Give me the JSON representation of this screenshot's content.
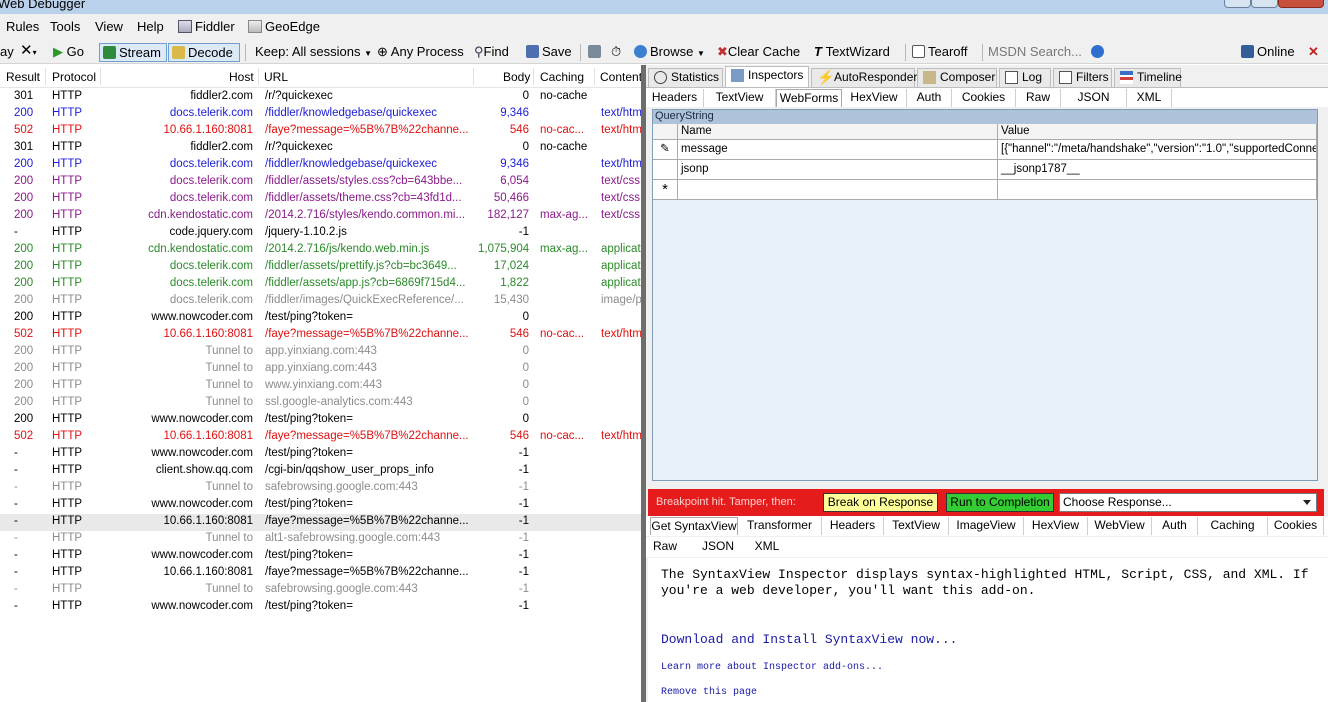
{
  "window": {
    "title": "Web Debugger"
  },
  "menu": [
    "Rules",
    "Tools",
    "View",
    "Help",
    "Fiddler",
    "GeoEdge"
  ],
  "toolbar": {
    "replay": "ay",
    "go": "Go",
    "stream": "Stream",
    "decode": "Decode",
    "keep": "Keep: All sessions",
    "process": "Any Process",
    "find": "Find",
    "save": "Save",
    "browse": "Browse",
    "clear_cache": "Clear Cache",
    "textwizard": "TextWizard",
    "tearoff": "Tearoff",
    "msdn_placeholder": "MSDN Search...",
    "online": "Online"
  },
  "sessions": {
    "columns": [
      "Result",
      "Protocol",
      "Host",
      "URL",
      "Body",
      "Caching",
      "Content"
    ],
    "rows": [
      {
        "result": "301",
        "protocol": "HTTP",
        "host": "fiddler2.com",
        "url": "/r/?quickexec",
        "body": "0",
        "caching": "no-cache",
        "content": "",
        "color": "#000000"
      },
      {
        "result": "200",
        "protocol": "HTTP",
        "host": "docs.telerik.com",
        "url": "/fiddler/knowledgebase/quickexec",
        "body": "9,346",
        "caching": "",
        "content": "text/htm",
        "color": "#1c1cd6"
      },
      {
        "result": "502",
        "protocol": "HTTP",
        "host": "10.66.1.160:8081",
        "url": "/faye?message=%5B%7B%22channe...",
        "body": "546",
        "caching": "no-cac...",
        "content": "text/htm",
        "color": "#e01010"
      },
      {
        "result": "301",
        "protocol": "HTTP",
        "host": "fiddler2.com",
        "url": "/r/?quickexec",
        "body": "0",
        "caching": "no-cache",
        "content": "",
        "color": "#000000"
      },
      {
        "result": "200",
        "protocol": "HTTP",
        "host": "docs.telerik.com",
        "url": "/fiddler/knowledgebase/quickexec",
        "body": "9,346",
        "caching": "",
        "content": "text/htm",
        "color": "#1c1cd6"
      },
      {
        "result": "200",
        "protocol": "HTTP",
        "host": "docs.telerik.com",
        "url": "/fiddler/assets/styles.css?cb=643bbe...",
        "body": "6,054",
        "caching": "",
        "content": "text/css",
        "color": "#8b1a8b"
      },
      {
        "result": "200",
        "protocol": "HTTP",
        "host": "docs.telerik.com",
        "url": "/fiddler/assets/theme.css?cb=43fd1d...",
        "body": "50,466",
        "caching": "",
        "content": "text/css",
        "color": "#8b1a8b"
      },
      {
        "result": "200",
        "protocol": "HTTP",
        "host": "cdn.kendostatic.com",
        "url": "/2014.2.716/styles/kendo.common.mi...",
        "body": "182,127",
        "caching": "max-ag...",
        "content": "text/css",
        "color": "#8b1a8b"
      },
      {
        "result": "-",
        "protocol": "HTTP",
        "host": "code.jquery.com",
        "url": "/jquery-1.10.2.js",
        "body": "-1",
        "caching": "",
        "content": "",
        "color": "#000000"
      },
      {
        "result": "200",
        "protocol": "HTTP",
        "host": "cdn.kendostatic.com",
        "url": "/2014.2.716/js/kendo.web.min.js",
        "body": "1,075,904",
        "caching": "max-ag...",
        "content": "applicati",
        "color": "#2a8a2a"
      },
      {
        "result": "200",
        "protocol": "HTTP",
        "host": "docs.telerik.com",
        "url": "/fiddler/assets/prettify.js?cb=bc3649...",
        "body": "17,024",
        "caching": "",
        "content": "applicati",
        "color": "#2a8a2a"
      },
      {
        "result": "200",
        "protocol": "HTTP",
        "host": "docs.telerik.com",
        "url": "/fiddler/assets/app.js?cb=6869f715d4...",
        "body": "1,822",
        "caching": "",
        "content": "applicati",
        "color": "#2a8a2a"
      },
      {
        "result": "200",
        "protocol": "HTTP",
        "host": "docs.telerik.com",
        "url": "/fiddler/images/QuickExecReference/...",
        "body": "15,430",
        "caching": "",
        "content": "image/pr",
        "color": "#8c8c8c"
      },
      {
        "result": "200",
        "protocol": "HTTP",
        "host": "www.nowcoder.com",
        "url": "/test/ping?token=",
        "body": "0",
        "caching": "",
        "content": "",
        "color": "#000000"
      },
      {
        "result": "502",
        "protocol": "HTTP",
        "host": "10.66.1.160:8081",
        "url": "/faye?message=%5B%7B%22channe...",
        "body": "546",
        "caching": "no-cac...",
        "content": "text/htm",
        "color": "#e01010"
      },
      {
        "result": "200",
        "protocol": "HTTP",
        "host": "Tunnel to",
        "url": "app.yinxiang.com:443",
        "body": "0",
        "caching": "",
        "content": "",
        "color": "#8c8c8c"
      },
      {
        "result": "200",
        "protocol": "HTTP",
        "host": "Tunnel to",
        "url": "app.yinxiang.com:443",
        "body": "0",
        "caching": "",
        "content": "",
        "color": "#8c8c8c"
      },
      {
        "result": "200",
        "protocol": "HTTP",
        "host": "Tunnel to",
        "url": "www.yinxiang.com:443",
        "body": "0",
        "caching": "",
        "content": "",
        "color": "#8c8c8c"
      },
      {
        "result": "200",
        "protocol": "HTTP",
        "host": "Tunnel to",
        "url": "ssl.google-analytics.com:443",
        "body": "0",
        "caching": "",
        "content": "",
        "color": "#8c8c8c"
      },
      {
        "result": "200",
        "protocol": "HTTP",
        "host": "www.nowcoder.com",
        "url": "/test/ping?token=",
        "body": "0",
        "caching": "",
        "content": "",
        "color": "#000000"
      },
      {
        "result": "502",
        "protocol": "HTTP",
        "host": "10.66.1.160:8081",
        "url": "/faye?message=%5B%7B%22channe...",
        "body": "546",
        "caching": "no-cac...",
        "content": "text/htm",
        "color": "#e01010"
      },
      {
        "result": "-",
        "protocol": "HTTP",
        "host": "www.nowcoder.com",
        "url": "/test/ping?token=",
        "body": "-1",
        "caching": "",
        "content": "",
        "color": "#000000"
      },
      {
        "result": "-",
        "protocol": "HTTP",
        "host": "client.show.qq.com",
        "url": "/cgi-bin/qqshow_user_props_info",
        "body": "-1",
        "caching": "",
        "content": "",
        "color": "#000000"
      },
      {
        "result": "-",
        "protocol": "HTTP",
        "host": "Tunnel to",
        "url": "safebrowsing.google.com:443",
        "body": "-1",
        "caching": "",
        "content": "",
        "color": "#8c8c8c"
      },
      {
        "result": "-",
        "protocol": "HTTP",
        "host": "www.nowcoder.com",
        "url": "/test/ping?token=",
        "body": "-1",
        "caching": "",
        "content": "",
        "color": "#000000"
      },
      {
        "result": "-",
        "protocol": "HTTP",
        "host": "10.66.1.160:8081",
        "url": "/faye?message=%5B%7B%22channe...",
        "body": "-1",
        "caching": "",
        "content": "",
        "color": "#000000",
        "selected": true
      },
      {
        "result": "-",
        "protocol": "HTTP",
        "host": "Tunnel to",
        "url": "alt1-safebrowsing.google.com:443",
        "body": "-1",
        "caching": "",
        "content": "",
        "color": "#8c8c8c"
      },
      {
        "result": "-",
        "protocol": "HTTP",
        "host": "www.nowcoder.com",
        "url": "/test/ping?token=",
        "body": "-1",
        "caching": "",
        "content": "",
        "color": "#000000"
      },
      {
        "result": "-",
        "protocol": "HTTP",
        "host": "10.66.1.160:8081",
        "url": "/faye?message=%5B%7B%22channe...",
        "body": "-1",
        "caching": "",
        "content": "",
        "color": "#000000"
      },
      {
        "result": "-",
        "protocol": "HTTP",
        "host": "Tunnel to",
        "url": "safebrowsing.google.com:443",
        "body": "-1",
        "caching": "",
        "content": "",
        "color": "#8c8c8c"
      },
      {
        "result": "-",
        "protocol": "HTTP",
        "host": "www.nowcoder.com",
        "url": "/test/ping?token=",
        "body": "-1",
        "caching": "",
        "content": "",
        "color": "#000000"
      }
    ]
  },
  "tabs": [
    "Statistics",
    "Inspectors",
    "AutoResponder",
    "Composer",
    "Log",
    "Filters",
    "Timeline"
  ],
  "request_tabs": [
    "Headers",
    "TextView",
    "WebForms",
    "HexView",
    "Auth",
    "Cookies",
    "Raw",
    "JSON",
    "XML"
  ],
  "querystring": {
    "title": "QueryString",
    "name_header": "Name",
    "value_header": "Value",
    "rows": [
      {
        "name": "message",
        "value": "[{\"hannel\":\"/meta/handshake\",\"version\":\"1.0\",\"supportedConne"
      },
      {
        "name": "jsonp",
        "value": "__jsonp1787__"
      }
    ],
    "new_row_marker": "*"
  },
  "breakpoint": {
    "label": "Breakpoint hit. Tamper, then:",
    "break_on_response": "Break on Response",
    "run_to_completion": "Run to Completion",
    "choose_response": "Choose Response..."
  },
  "response_tabs_row1": [
    "Get SyntaxView",
    "Transformer",
    "Headers",
    "TextView",
    "ImageView",
    "HexView",
    "WebView",
    "Auth",
    "Caching",
    "Cookies"
  ],
  "response_tabs_row2": [
    "Raw",
    "JSON",
    "XML"
  ],
  "syntaxview": {
    "line1": "The SyntaxView Inspector displays syntax-highlighted HTML, Script, CSS, and XML. If",
    "line2": "you're a web developer, you'll want this add-on.",
    "download": "Download and Install SyntaxView now...",
    "learn": "Learn more about Inspector add-ons...",
    "remove": "Remove this page"
  },
  "colors": {
    "accent": "#e61c1c",
    "selected_tab": "#ffffff",
    "grid_header": "#aec3da"
  }
}
